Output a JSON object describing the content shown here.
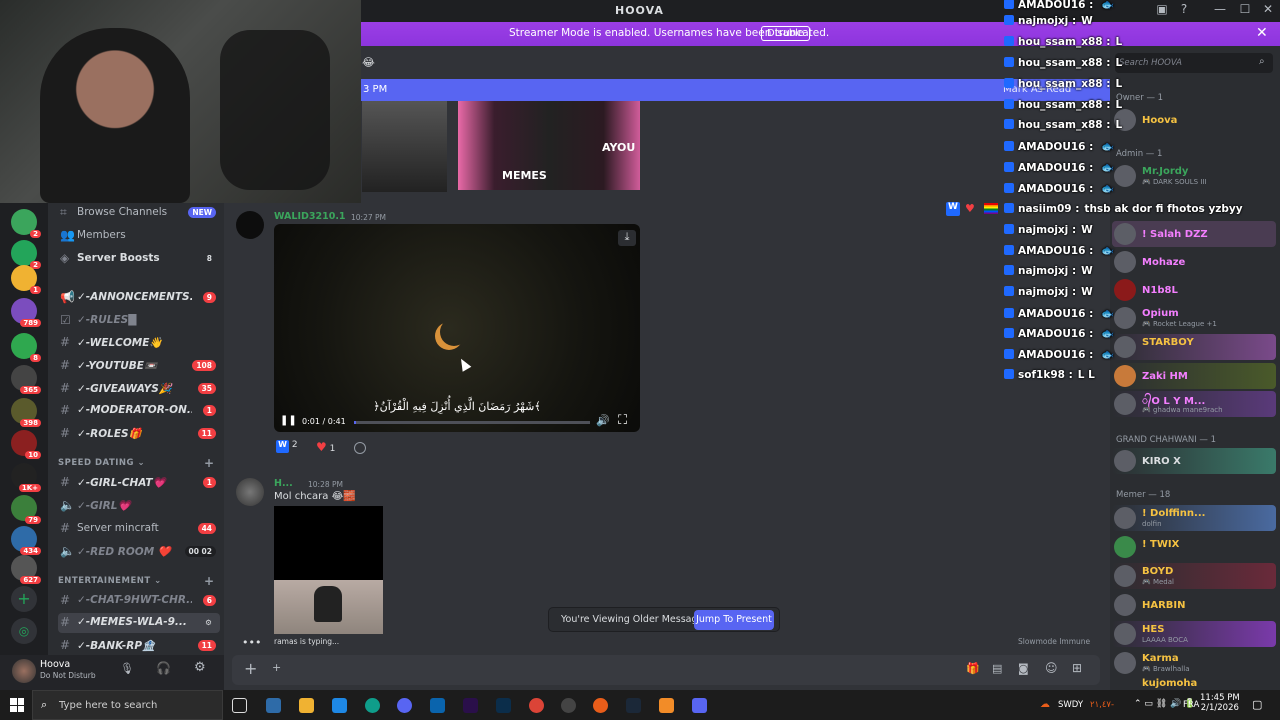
{
  "window": {
    "title": "HOOVA",
    "minimize": "—",
    "maximize": "☐",
    "close": "✕"
  },
  "streamer_bar": {
    "message": "Streamer Mode is enabled. Usernames have been truncated.",
    "disable": "Disable"
  },
  "new_messages_bar": {
    "time": "3 PM",
    "mark_read": "Mark As Read"
  },
  "search": {
    "placeholder": "Search HOOVA"
  },
  "server_badges": [
    "2",
    "2",
    "1",
    "789",
    "8",
    "365",
    "398",
    "10",
    "1K+",
    "79",
    "434",
    "627"
  ],
  "channels": {
    "browse": "Browse Channels",
    "new_badge": "NEW",
    "members": "Members",
    "boosts": "Server Boosts",
    "boosts_count": "8",
    "list": [
      {
        "name": "✓-ANNONCEMENTS...",
        "count": "9"
      },
      {
        "name": "✓-RULES█",
        "count": ""
      },
      {
        "name": "✓-WELCOME👋",
        "count": ""
      },
      {
        "name": "✓-YOUTUBE📼",
        "count": "108"
      },
      {
        "name": "✓-GIVEAWAYS🎉",
        "count": "35"
      },
      {
        "name": "✓-MODERATOR-ON...",
        "count": "1"
      },
      {
        "name": "✓-ROLES🎁",
        "count": "11"
      }
    ],
    "cat_speed": "SPEED DATING",
    "speed": [
      {
        "name": "✓-GIRL-CHAT💗",
        "count": "1"
      },
      {
        "name": "✓-GIRL💗",
        "count": ""
      },
      {
        "name": "Server mincraft",
        "count": "44"
      },
      {
        "name": "✓-RED ROOM ❤️",
        "count": "00  02"
      }
    ],
    "cat_ent": "ENTERTAINEMENT",
    "ent": [
      {
        "name": "✓-CHAT-9HWT-CHR...",
        "count": "6"
      },
      {
        "name": "✓-MEMES-WLA-9...",
        "count": ""
      },
      {
        "name": "✓-BANK-RP🏦",
        "count": "11"
      }
    ]
  },
  "user": {
    "name": "Hoova",
    "status": "Do Not Disturb"
  },
  "chat": {
    "video_author": "WALID3210.1",
    "video_time": "10:27 PM",
    "video_subtitle": "﴿شَهْرُ رَمَضَانَ الَّذِي أُنْزِلَ فِيهِ الْقُرْآنُ﴾",
    "video_timecode": "0:01 / 0:41",
    "reaction_w": "2",
    "reaction_heart": "1",
    "msg_author": "H...",
    "msg_time": "10:28 PM",
    "msg_text": "Mol chcara 😂🧱",
    "typing": "ramas is typing...",
    "slowmode": "Slowmode Immune",
    "older": "You're Viewing Older Messages",
    "jump": "Jump To Present",
    "thumb_text": "AYOU",
    "memes_text": "MEMES"
  },
  "stream_chat": [
    {
      "user": "AMADOU16 :",
      "msg": ""
    },
    {
      "user": "najmojxj :",
      "msg": "W"
    },
    {
      "user": "hou_ssam_x88 :",
      "msg": "L"
    },
    {
      "user": "hou_ssam_x88 :",
      "msg": "L"
    },
    {
      "user": "hou_ssam_x88 :",
      "msg": "L"
    },
    {
      "user": "hou_ssam_x88 :",
      "msg": "L"
    },
    {
      "user": "hou_ssam_x88 :",
      "msg": "L"
    },
    {
      "user": "AMADOU16 :",
      "msg": ""
    },
    {
      "user": "AMADOU16 :",
      "msg": ""
    },
    {
      "user": "AMADOU16 :",
      "msg": ""
    },
    {
      "user": "nasiim09 :",
      "msg": "thsb ak dor fi fhotos yzbyy"
    },
    {
      "user": "najmojxj :",
      "msg": "W"
    },
    {
      "user": "AMADOU16 :",
      "msg": ""
    },
    {
      "user": "najmojxj :",
      "msg": "W"
    },
    {
      "user": "najmojxj :",
      "msg": "W"
    },
    {
      "user": "AMADOU16 :",
      "msg": ""
    },
    {
      "user": "AMADOU16 :",
      "msg": ""
    },
    {
      "user": "AMADOU16 :",
      "msg": ""
    },
    {
      "user": "sof1k98 :",
      "msg": "L  L"
    }
  ],
  "members": {
    "owner_group": "Owner — 1",
    "owner": "Hoova",
    "admin_group": "Admin — 1",
    "admin": "Mr.Jordy",
    "admin_sub": "🎮 DARK SOULS III",
    "list": [
      {
        "name": "! Salah DZZ",
        "sub": "",
        "color": "#f47fff"
      },
      {
        "name": "Mohaze",
        "sub": "",
        "color": "#f47fff"
      },
      {
        "name": "N1b8L",
        "sub": "",
        "color": "#f47fff"
      },
      {
        "name": "Opium",
        "sub": "🎮 Rocket League +1",
        "color": "#f47fff"
      },
      {
        "name": "STARBOY",
        "sub": "",
        "color": "#f5c242"
      },
      {
        "name": "Zaki HM",
        "sub": "",
        "color": "#f47fff"
      },
      {
        "name": "᭄O L Y M...",
        "sub": "🎮 ghadwa mane9rach",
        "color": "#f47fff"
      }
    ],
    "grand_group": "GRAND CHAHWANI — 1",
    "grand": "KIRO X",
    "memer_group": "Memer — 18",
    "memers": [
      {
        "name": "! Dolffinn...",
        "sub": "dolfin",
        "color": "#f5c242"
      },
      {
        "name": "! TWIX",
        "sub": "",
        "color": "#f5c242"
      },
      {
        "name": "BOYD",
        "sub": "🎮 Medal",
        "color": "#f5c242"
      },
      {
        "name": "HARBIN",
        "sub": "",
        "color": "#f5c242"
      },
      {
        "name": "HES",
        "sub": "LAAAA BOCA",
        "color": "#f5c242"
      },
      {
        "name": "Karma",
        "sub": "🎮 Brawlhalla",
        "color": "#f5c242"
      },
      {
        "name": "kujomoha",
        "sub": "",
        "color": "#f5c242"
      }
    ]
  },
  "taskbar": {
    "search": "Type here to search",
    "weather": "SWDY",
    "weather2": "٢١,٤٧-",
    "lang": "FRA",
    "time": "11:45 PM",
    "date": "2/1/2026"
  }
}
